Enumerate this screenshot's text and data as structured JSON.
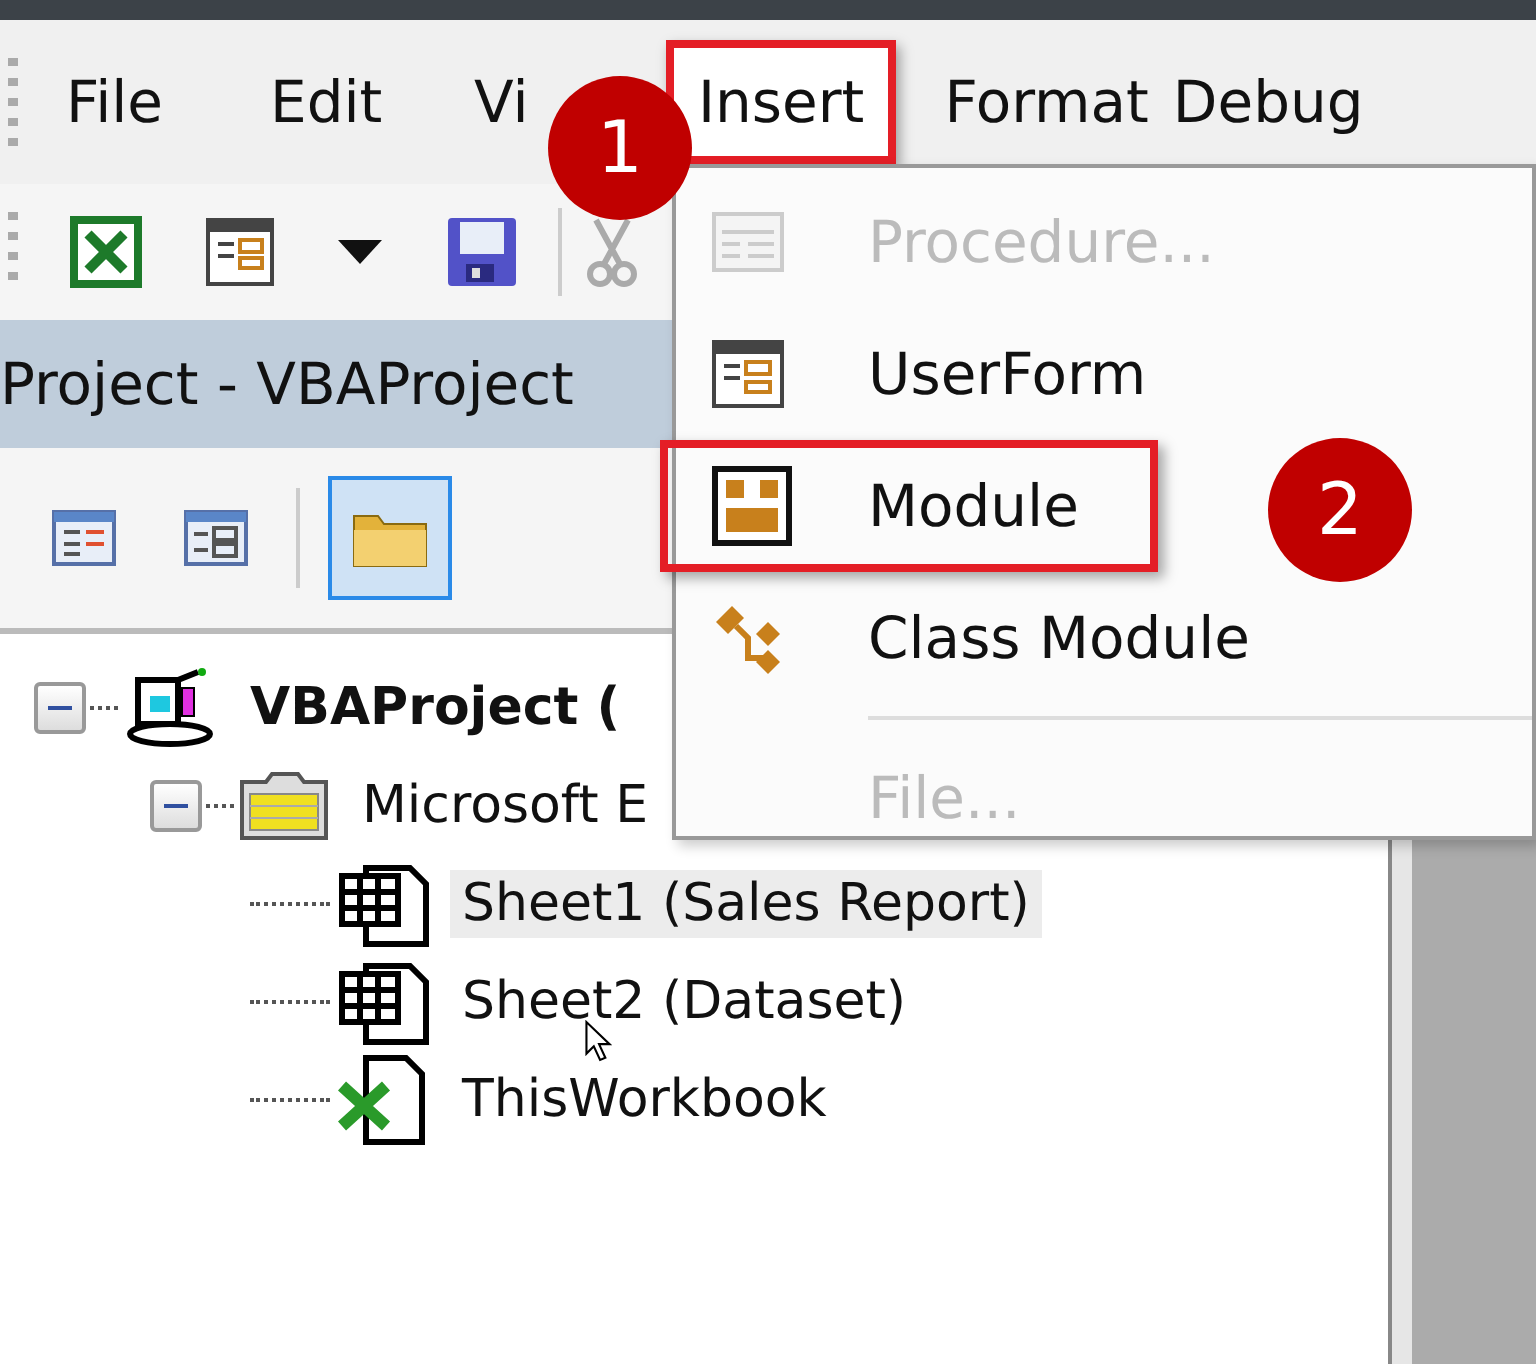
{
  "menu_bar": [
    {
      "label": "File",
      "selected": false,
      "highlighted": false
    },
    {
      "label": "Edit",
      "selected": false,
      "highlighted": false
    },
    {
      "label": "Vi",
      "selected": false,
      "highlighted": false
    },
    {
      "label": "Insert",
      "selected": true,
      "highlighted": true
    },
    {
      "label": "Format",
      "selected": false,
      "highlighted": false
    },
    {
      "label": "Debug",
      "selected": false,
      "highlighted": false
    }
  ],
  "toolbar": [
    {
      "kind": "excel",
      "disabled": false
    },
    {
      "kind": "userform",
      "disabled": false
    },
    {
      "kind": "dropdown",
      "disabled": false
    },
    {
      "kind": "save",
      "disabled": false
    },
    {
      "kind": "separator"
    },
    {
      "kind": "cut",
      "disabled": true
    }
  ],
  "project_panel": {
    "title": "Project - VBAProject",
    "toolbar": [
      {
        "kind": "view-code",
        "selected": false
      },
      {
        "kind": "view-object",
        "selected": false
      },
      {
        "kind": "separator"
      },
      {
        "kind": "folder",
        "selected": true
      }
    ],
    "tree": [
      {
        "label": "VBAProject (",
        "kind": "project",
        "expanded": true,
        "selected": false,
        "children": [
          {
            "label": "Microsoft E",
            "kind": "folder",
            "expanded": true,
            "selected": false,
            "children": [
              {
                "label": "Sheet1 (Sales Report)",
                "kind": "sheet",
                "selected": true
              },
              {
                "label": "Sheet2 (Dataset)",
                "kind": "sheet",
                "selected": false
              },
              {
                "label": "ThisWorkbook",
                "kind": "workbook",
                "selected": false
              }
            ]
          }
        ]
      }
    ]
  },
  "insert_menu": [
    {
      "label": "Procedure...",
      "kind": "procedure",
      "disabled": true,
      "highlighted": false
    },
    {
      "label": "UserForm",
      "kind": "userform",
      "disabled": false,
      "highlighted": false
    },
    {
      "label": "Module",
      "kind": "module",
      "disabled": false,
      "highlighted": true
    },
    {
      "label": "Class Module",
      "kind": "class",
      "disabled": false,
      "highlighted": false
    },
    {
      "kind": "separator"
    },
    {
      "label": "File...",
      "kind": "file",
      "disabled": true,
      "highlighted": false
    }
  ],
  "callouts": [
    {
      "text": "1"
    },
    {
      "text": "2"
    }
  ]
}
